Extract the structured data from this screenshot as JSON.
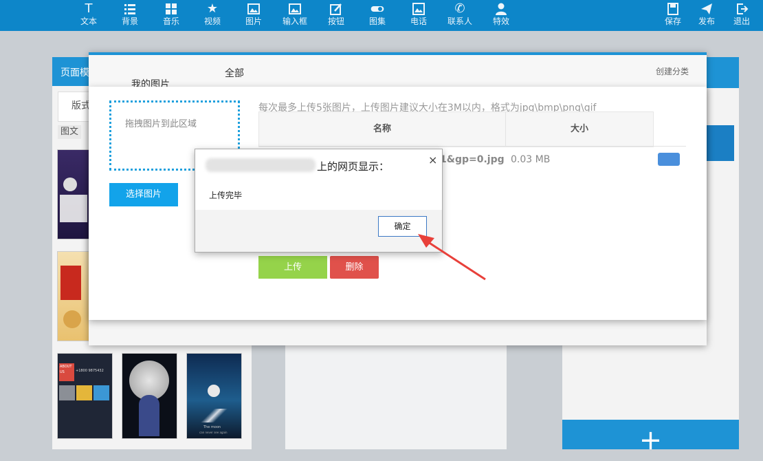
{
  "toolbar": {
    "items": [
      {
        "label": "文本",
        "icon": "text-icon"
      },
      {
        "label": "背景",
        "icon": "background-icon"
      },
      {
        "label": "音乐",
        "icon": "music-icon"
      },
      {
        "label": "视频",
        "icon": "video-icon"
      },
      {
        "label": "图片",
        "icon": "image-icon"
      },
      {
        "label": "输入框",
        "icon": "input-box-icon"
      },
      {
        "label": "按钮",
        "icon": "button-icon"
      },
      {
        "label": "图集",
        "icon": "gallery-icon"
      },
      {
        "label": "电话",
        "icon": "phone-icon"
      },
      {
        "label": "联系人",
        "icon": "contact-icon"
      },
      {
        "label": "特效",
        "icon": "effects-icon"
      }
    ],
    "right": [
      {
        "label": "保存",
        "icon": "save-icon"
      },
      {
        "label": "发布",
        "icon": "publish-icon"
      },
      {
        "label": "退出",
        "icon": "logout-icon"
      }
    ]
  },
  "background": {
    "left_header": "页面模",
    "left_tab": "版式",
    "left_filter": "图文",
    "add_symbol": "+",
    "thumb_texts": {
      "about": "ABOUT US",
      "phone": "+1800 9875432",
      "moon": "The moon",
      "moon_sub": "can never see again"
    }
  },
  "library": {
    "my_images": "我的图片",
    "all": "全部",
    "create_category": "创建分类"
  },
  "upload": {
    "dropzone_text": "拖拽图片到此区域",
    "choose_button": "选择图片",
    "hint": "每次最多上传5张图片，上传图片建议大小在3M以内，格式为jpg\\bmp\\png\\gif",
    "col_name": "名称",
    "col_size": "大小",
    "file_name": "1&gp=0.jpg",
    "file_size": "0.03 MB",
    "upload_button": "上传",
    "delete_button": "删除"
  },
  "alert": {
    "title": "上的网页显示：",
    "close": "×",
    "message": "上传完毕",
    "ok_button": "确定"
  },
  "colors": {
    "topbar": "#0d86c9",
    "accent": "#1e93d5",
    "upload_green": "#95d34a",
    "delete_red": "#e0514b",
    "arrow_red": "#e8403a"
  }
}
